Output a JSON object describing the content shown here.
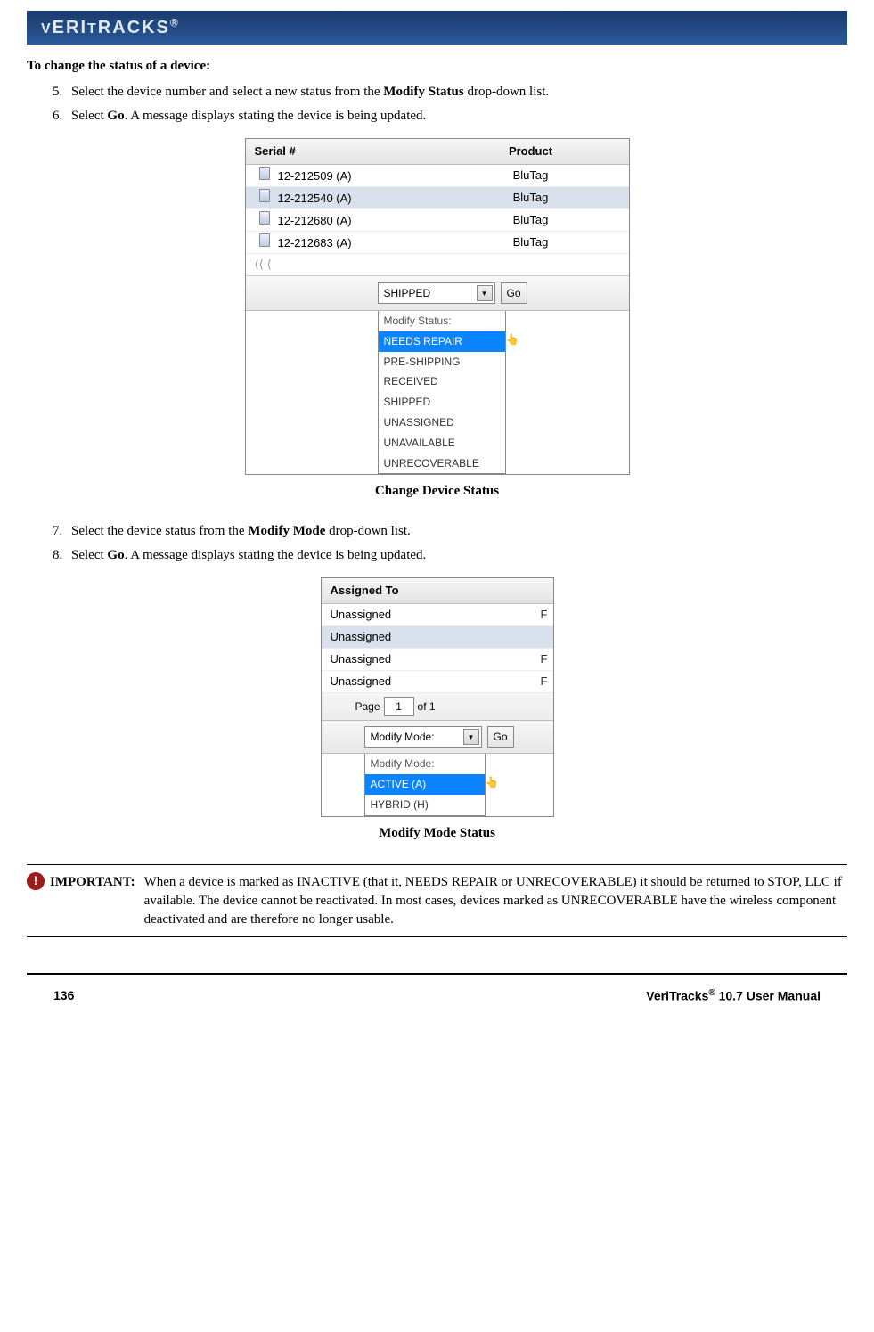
{
  "brand": "VERITRACKS®",
  "section_title": "To change the status of a device:",
  "steps_a": {
    "5": {
      "prefix": "Select the device number and select a new status from the ",
      "bold": "Modify Status",
      "suffix": " drop-down list."
    },
    "6": {
      "prefix": "Select ",
      "bold": "Go",
      "suffix": ". A message displays stating the device is being updated."
    }
  },
  "figure1": {
    "columns": {
      "c1": "Serial #",
      "c2": "Product"
    },
    "rows": [
      {
        "serial": "12-212509 (A)",
        "product": "BluTag"
      },
      {
        "serial": "12-212540 (A)",
        "product": "BluTag"
      },
      {
        "serial": "12-212680 (A)",
        "product": "BluTag"
      },
      {
        "serial": "12-212683 (A)",
        "product": "BluTag"
      }
    ],
    "pager": {
      "a": "⟨⟨",
      "b": "⟨"
    },
    "selected_value": "SHIPPED",
    "go_label": "Go",
    "dropdown_label": "Modify Status:",
    "options": [
      "NEEDS REPAIR",
      "PRE-SHIPPING",
      "RECEIVED",
      "SHIPPED",
      "UNASSIGNED",
      "UNAVAILABLE",
      "UNRECOVERABLE"
    ],
    "caption": "Change Device Status"
  },
  "steps_b": {
    "7": {
      "prefix": "Select the device status from the ",
      "bold": "Modify Mode",
      "suffix": " drop-down list."
    },
    "8": {
      "prefix": "Select ",
      "bold": "Go",
      "suffix": ". A message displays stating the device is being updated."
    }
  },
  "figure2": {
    "header": "Assigned To",
    "rows": [
      {
        "val": "Unassigned",
        "r": "F"
      },
      {
        "val": "Unassigned",
        "r": ""
      },
      {
        "val": "Unassigned",
        "r": "F"
      },
      {
        "val": "Unassigned",
        "r": "F"
      }
    ],
    "pager": {
      "label_pre": "Page",
      "value": "1",
      "label_post": "of 1"
    },
    "selected_value": "Modify Mode:",
    "go_label": "Go",
    "dropdown_label": "Modify Mode:",
    "options": [
      "ACTIVE (A)",
      "HYBRID (H)"
    ],
    "caption": "Modify Mode Status"
  },
  "important": {
    "icon": "!",
    "label": "IMPORTANT:",
    "text": "When a device is marked as INACTIVE (that it, NEEDS REPAIR or UNRECOVERABLE) it should be returned to STOP, LLC if available. The device cannot be reactivated.  In most cases, devices marked as UNRECOVERABLE have the wireless component deactivated and are therefore no longer usable."
  },
  "footer": {
    "page": "136",
    "title_pre": "VeriTracks",
    "title_sup": "®",
    "title_post": " 10.7 User Manual"
  }
}
